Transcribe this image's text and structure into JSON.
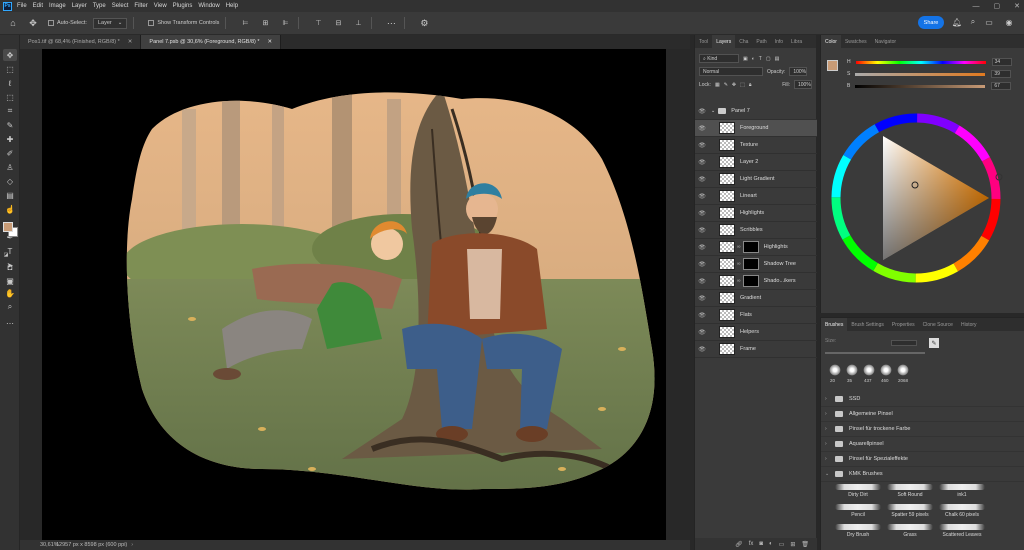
{
  "menubar": {
    "logo": "Ps",
    "items": [
      "File",
      "Edit",
      "Image",
      "Layer",
      "Type",
      "Select",
      "Filter",
      "View",
      "Plugins",
      "Window",
      "Help"
    ],
    "window_controls": [
      "—",
      "▢",
      "✕"
    ]
  },
  "options": {
    "auto_select_label": "Auto-Select:",
    "auto_select_value": "Layer",
    "show_transform_label": "Show Transform Controls",
    "share_label": "Share"
  },
  "tabs": [
    {
      "label": "Pos1.tif @ 68,4% (Finished, RGB/8) *",
      "close": "✕"
    },
    {
      "label": "Panel 7.psb @ 30,6% (Foreground, RGB/8) *",
      "close": "✕"
    }
  ],
  "status": {
    "zoom": "30,61%",
    "doc_info": "12957 px x 8598 px (600 ppi)"
  },
  "layers_panel": {
    "tabs": [
      "Tool",
      "Layers",
      "Cha",
      "Path",
      "Info",
      "Libra"
    ],
    "active_tab": "Layers",
    "kind_label": "Kind",
    "blend_mode": "Normal",
    "opacity_label": "Opacity:",
    "opacity_value": "100%",
    "lock_label": "Lock:",
    "fill_label": "Fill:",
    "fill_value": "100%",
    "group_name": "Panel 7",
    "layers": [
      {
        "name": "Foreground",
        "selected": true,
        "mask": false
      },
      {
        "name": "Texture",
        "selected": false,
        "mask": false
      },
      {
        "name": "Layer 2",
        "selected": false,
        "mask": false
      },
      {
        "name": "Light Gradient",
        "selected": false,
        "mask": false
      },
      {
        "name": "Lineart",
        "selected": false,
        "mask": false
      },
      {
        "name": "Highlights",
        "selected": false,
        "mask": false
      },
      {
        "name": "Scribbles",
        "selected": false,
        "mask": false
      },
      {
        "name": "Highlights",
        "selected": false,
        "mask": true
      },
      {
        "name": "Shadow Tree",
        "selected": false,
        "mask": true
      },
      {
        "name": "Shado...ikers",
        "selected": false,
        "mask": true
      },
      {
        "name": "Gradient",
        "selected": false,
        "mask": false
      },
      {
        "name": "Flats",
        "selected": false,
        "mask": false
      },
      {
        "name": "Helpers",
        "selected": false,
        "mask": false
      },
      {
        "name": "Frame",
        "selected": false,
        "mask": false
      }
    ]
  },
  "color_panel": {
    "tabs": [
      "Color",
      "Swatches",
      "Navigator"
    ],
    "active_tab": "Color",
    "fg_color": "#c89b76",
    "h_label": "H",
    "h_value": "34",
    "s_label": "S",
    "s_value": "39",
    "b_label": "B",
    "b_value": "67"
  },
  "brushes_panel": {
    "tabs": [
      "Brushes",
      "Brush Settings",
      "Properties",
      "Clone Source",
      "History"
    ],
    "active_tab": "Brushes",
    "size_label": "Size:",
    "presets": [
      "20",
      "35",
      "437",
      "460",
      "2068"
    ],
    "folders": [
      "SSD",
      "Allgemeine Pinsel",
      "Pinsel für trockene Farbe",
      "Aquarellpinsel",
      "Pinsel für Spezialeffekte",
      "KMK Brushes"
    ],
    "brushes": [
      "Dirty Dirt",
      "Soft Round",
      "ink1",
      "Pencil",
      "Spatter 59 pixels",
      "Chalk 60 pixels",
      "Dry Brush",
      "Grass",
      "Scattered Leaves"
    ]
  }
}
